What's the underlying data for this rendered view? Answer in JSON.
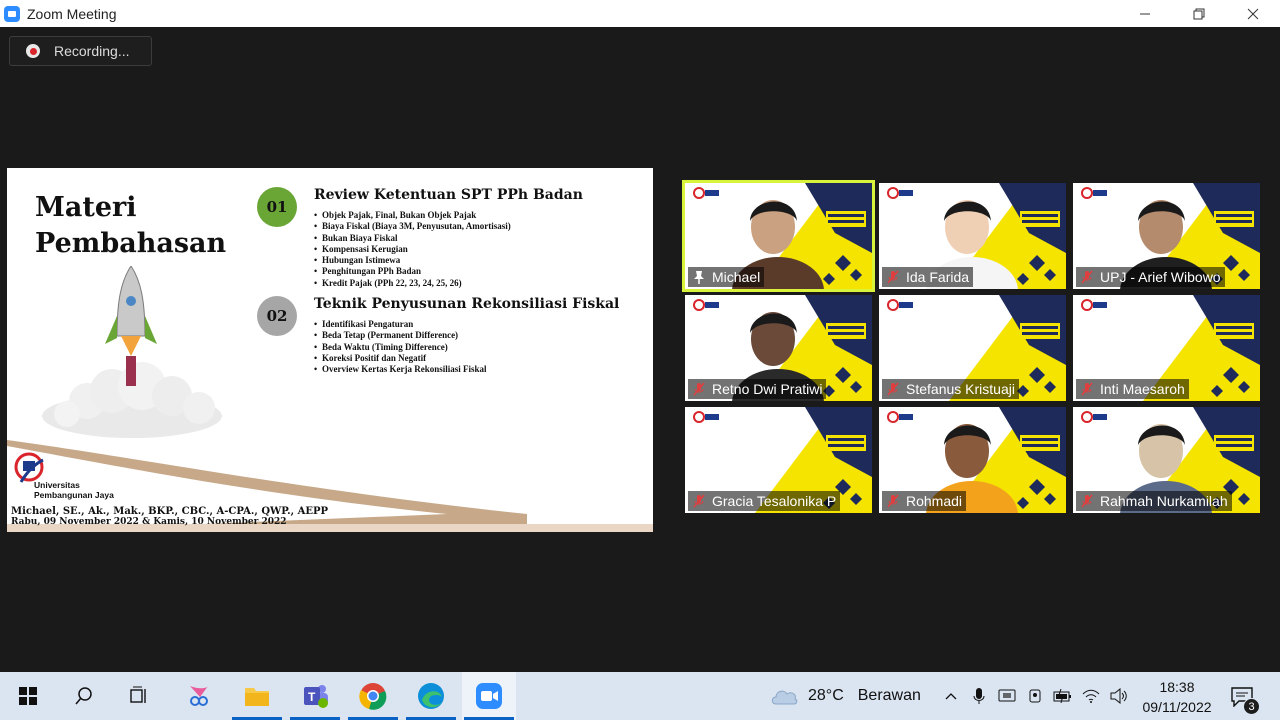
{
  "window": {
    "title": "Zoom Meeting",
    "controls": {
      "minimize": "—",
      "restore": "❐",
      "close": "✕"
    }
  },
  "recording": {
    "label": "Recording..."
  },
  "slide": {
    "title": "Materi Pembahasan",
    "sections": [
      {
        "number": "01",
        "title": "Review Ketentuan SPT PPh Badan",
        "items": [
          "Objek Pajak, Final, Bukan Objek Pajak",
          "Biaya Fiskal (Biaya 3M, Penyusutan, Amortisasi)",
          "Bukan Biaya Fiskal",
          "Kompensasi Kerugian",
          "Hubungan Istimewa",
          "Penghitungan PPh Badan",
          "Kredit Pajak (PPh 22, 23, 24, 25, 26)"
        ]
      },
      {
        "number": "02",
        "title": "Teknik Penyusunan Rekonsiliasi Fiskal",
        "items": [
          "Identifikasi Pengaturan",
          "Beda Tetap (Permanent Difference)",
          "Beda Waktu (Timing Difference)",
          "Koreksi Positif dan Negatif",
          "Overview Kertas Kerja Rekonsiliasi Fiskal"
        ]
      }
    ],
    "university": "Universitas Pembangunan Jaya",
    "presenter": "Michael, SE., Ak., Mak., BKP., CBC., A-CPA., QWP., AEPP",
    "dates": "Rabu, 09 November 2022 & Kamis, 10 November 2022"
  },
  "participants": [
    {
      "name": "Michael",
      "muted": false,
      "pinned": true,
      "active": true
    },
    {
      "name": "Ida Farida",
      "muted": true
    },
    {
      "name": "UPJ - Arief Wibowo",
      "muted": true
    },
    {
      "name": "Retno Dwi Pratiwi",
      "muted": true
    },
    {
      "name": "Stefanus Kristuaji",
      "muted": true
    },
    {
      "name": "Inti Maesaroh",
      "muted": true
    },
    {
      "name": "Gracia Tesalonika P",
      "muted": true
    },
    {
      "name": "Rohmadi",
      "muted": true
    },
    {
      "name": "Rahmah Nurkamilah",
      "muted": true
    }
  ],
  "taskbar": {
    "apps": [
      "windows-start",
      "search",
      "task-view",
      "snipping-tool",
      "file-explorer",
      "teams",
      "chrome",
      "edge",
      "zoom"
    ],
    "weather": {
      "temp": "28°C",
      "desc": "Berawan"
    },
    "clock": {
      "time": "18:38",
      "date": "09/11/2022"
    },
    "notifications": "3"
  },
  "colors": {
    "accent_active_speaker": "#d9f23a",
    "brand_yellow": "#f5e400",
    "brand_navy": "#1e2a5a"
  }
}
